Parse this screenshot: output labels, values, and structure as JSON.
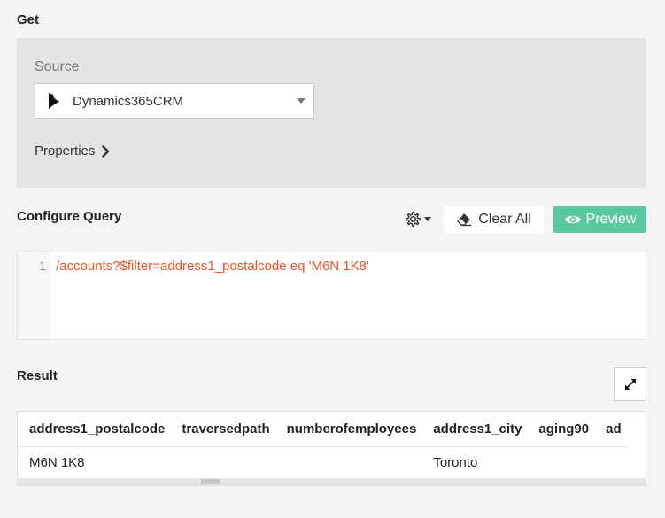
{
  "get": {
    "title": "Get",
    "source_label": "Source",
    "source_value": "Dynamics365CRM",
    "source_icon": "dynamics-logo-icon",
    "properties_label": "Properties"
  },
  "query": {
    "title": "Configure Query",
    "clear_label": "Clear All",
    "preview_label": "Preview",
    "preview_color": "#5cc8a0",
    "code_color": "#e8542a",
    "lines": [
      {
        "num": "1",
        "text": "/accounts?$filter=address1_postalcode eq 'M6N 1K8'"
      }
    ]
  },
  "result": {
    "title": "Result",
    "columns": [
      "address1_postalcode",
      "traversedpath",
      "numberofemployees",
      "address1_city",
      "aging90",
      "ad"
    ],
    "rows": [
      [
        "M6N 1K8",
        "",
        "",
        "Toronto",
        "",
        ""
      ]
    ]
  }
}
